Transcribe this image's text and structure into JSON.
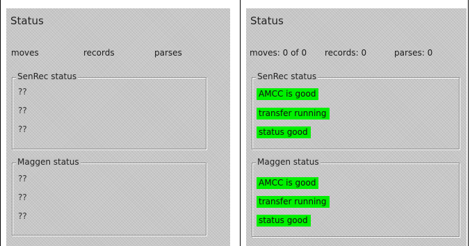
{
  "left": {
    "title": "Status",
    "counts": [
      "moves",
      "records",
      "parses"
    ],
    "groups": [
      {
        "label": "SenRec status",
        "items": [
          "??",
          "??",
          "??"
        ]
      },
      {
        "label": "Maggen status",
        "items": [
          "??",
          "??",
          "??"
        ]
      }
    ]
  },
  "right": {
    "title": "Status",
    "counts": [
      "moves: 0 of 0",
      "records: 0",
      "parses: 0"
    ],
    "groups": [
      {
        "label": "SenRec status",
        "items": [
          "AMCC is good",
          "transfer running",
          "status good"
        ]
      },
      {
        "label": "Maggen status",
        "items": [
          "AMCC is good",
          "transfer running",
          "status good"
        ]
      }
    ]
  },
  "colors": {
    "panel_background": "#c6c6c6",
    "status_good_highlight": "#00f000"
  }
}
